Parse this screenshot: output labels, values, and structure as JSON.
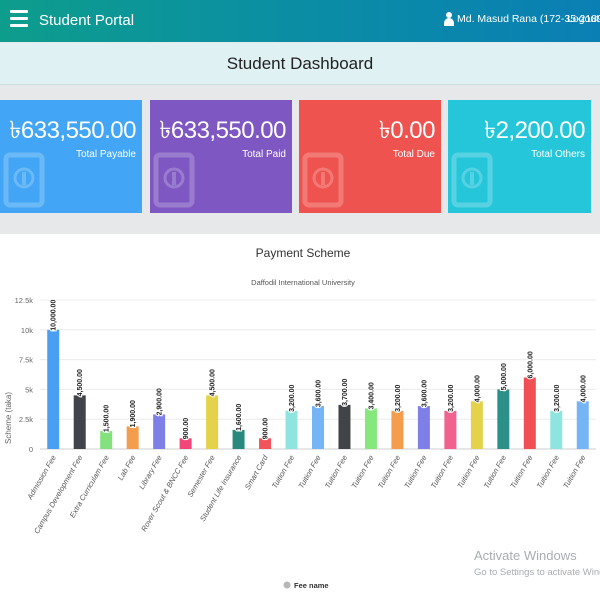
{
  "topbar": {
    "brand": "Student Portal",
    "user": "Md. Masud Rana (172-35-2189)",
    "logout": "Logout",
    "bg_start": "#0d9d8c",
    "bg_end": "#0a7fb4"
  },
  "dashboard": {
    "title": "Student Dashboard"
  },
  "cards": [
    {
      "amount": "৳633,550.00",
      "label": "Total Payable",
      "color": "#42a5f5",
      "icon": "university-logo-icon"
    },
    {
      "amount": "৳633,550.00",
      "label": "Total Paid",
      "color": "#7e57c2",
      "icon": "university-logo-icon"
    },
    {
      "amount": "৳0.00",
      "label": "Total Due",
      "color": "#ef5350",
      "icon": "university-logo-icon"
    },
    {
      "amount": "৳2,200.00",
      "label": "Total Others",
      "color": "#26c6da",
      "icon": "university-logo-icon"
    }
  ],
  "chart_data": {
    "type": "bar",
    "title": "Payment Scheme",
    "subtitle": "Daffodil International University",
    "ylabel": "Scheme (taka)",
    "ylim": [
      0,
      12500
    ],
    "yticks": [
      0,
      2500,
      5000,
      7500,
      10000,
      12500
    ],
    "ytick_labels": [
      "0",
      "2.5k",
      "5k",
      "7.5k",
      "10k",
      "12.5k"
    ],
    "grid": true,
    "legend": {
      "label": "Fee name",
      "placement": "bottom-center"
    },
    "categories": [
      "Admission Fee",
      "Campus Development Fee",
      "Extra Curriculam Fee",
      "Lab Fee",
      "Library Fee",
      "Rover Scout & BNCC Fee",
      "Semester Fee",
      "Student Life Insurance",
      "Smart Card",
      "Tuition Fee",
      "Tuition Fee",
      "Tuition Fee",
      "Tuition Fee",
      "Tuition Fee",
      "Tuition Fee",
      "Tuition Fee",
      "Tuition Fee",
      "Tuition Fee",
      "Tuition Fee",
      "Tuition Fee",
      "Tuition Fee"
    ],
    "values": [
      10000,
      4500,
      1500,
      1900,
      2900,
      900,
      4500,
      1600,
      900,
      3200,
      3600,
      3700,
      3400,
      3200,
      3600,
      3200,
      4000,
      5000,
      6000,
      3200,
      4000
    ],
    "data_labels": [
      "10,000.00",
      "4,500.00",
      "1,500.00",
      "1,900.00",
      "2,900.00",
      "900.00",
      "4,500.00",
      "1,600.00",
      "900.00",
      "3,200.00",
      "3,600.00",
      "3,700.00",
      "3,400.00",
      "3,200.00",
      "3,600.00",
      "3,200.00",
      "4,000.00",
      "5,000.00",
      "6,000.00",
      "3,200.00",
      "4,000.00"
    ],
    "colors": [
      "#4b9ff2",
      "#404448",
      "#83e27d",
      "#f59d4f",
      "#7f7fe8",
      "#f2457a",
      "#e3d24a",
      "#29897f",
      "#f2545b",
      "#8ee5e0",
      "#75b4f5",
      "#404448",
      "#86e77f",
      "#f59d4f",
      "#7f7fe8",
      "#f2628f",
      "#e3d24a",
      "#2b9188",
      "#ef4f55",
      "#8ee5e0",
      "#75b4f5"
    ]
  },
  "watermark": {
    "line1": "Activate Windows",
    "line2": "Go to Settings to activate Windows."
  }
}
